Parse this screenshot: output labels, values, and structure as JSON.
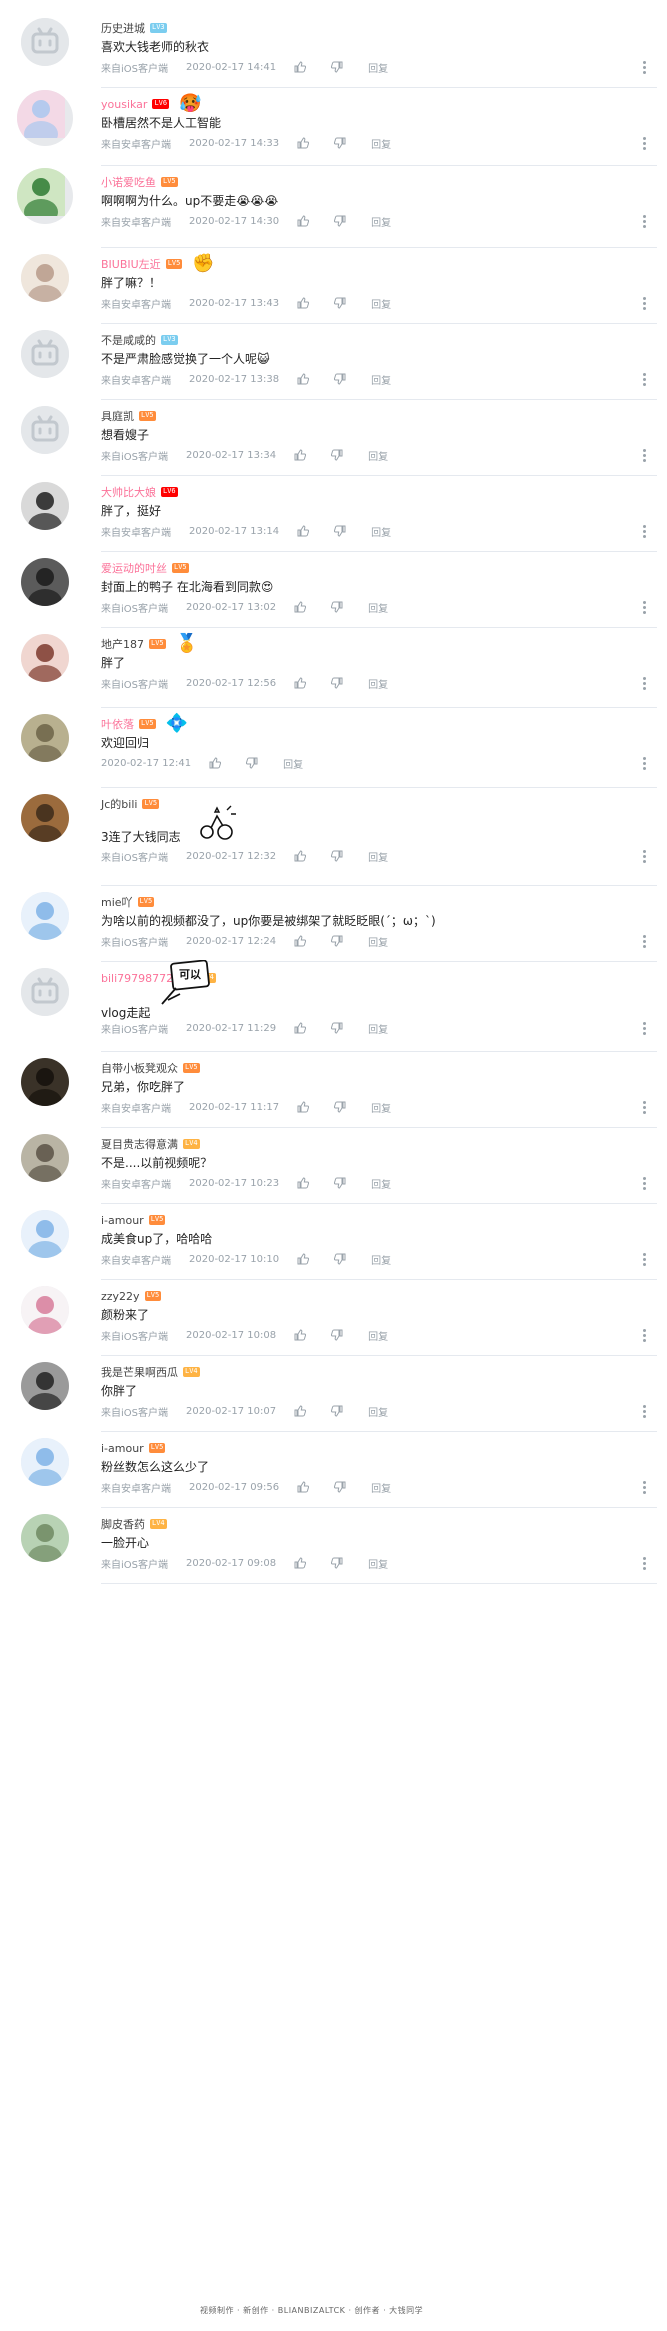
{
  "ui": {
    "reply_label": "回复",
    "colors": {
      "vip_name": "#fb7299",
      "meta": "#99a2aa",
      "separator": "#e5e9ef"
    }
  },
  "comments": [
    {
      "name": "历史进城",
      "vip": false,
      "level": "LV3",
      "text": "喜欢大钱老师的秋衣",
      "source": "来自iOS客户端",
      "time": "2020-02-17 14:41",
      "avatar": "default-tv-avatar",
      "pendant": ""
    },
    {
      "name": "yousikar",
      "vip": true,
      "level": "LV6",
      "text": "卧槽居然不是人工智能",
      "source": "来自安卓客户端",
      "time": "2020-02-17 14:33",
      "avatar": "pendant-frame-avatar",
      "pendant": "🥵"
    },
    {
      "name": "小诺爱吃鱼",
      "vip": true,
      "level": "LV5",
      "text": "啊啊啊为什么。up不要走😭😭😭",
      "source": "来自安卓客户端",
      "time": "2020-02-17 14:30",
      "avatar": "snake-frame-avatar",
      "pendant": ""
    },
    {
      "name": "BIUBIU左近",
      "vip": true,
      "level": "LV5",
      "text": "胖了嘛？！",
      "source": "来自安卓客户端",
      "time": "2020-02-17 13:43",
      "avatar": "anime-avatar",
      "pendant": "✊"
    },
    {
      "name": "不是咸咸的",
      "vip": false,
      "level": "LV3",
      "text": "不是严肃脸感觉换了一个人呢😺",
      "source": "来自安卓客户端",
      "time": "2020-02-17 13:38",
      "avatar": "default-tv-avatar",
      "pendant": ""
    },
    {
      "name": "具庭凯",
      "vip": false,
      "level": "LV5",
      "text": "想看嫂子",
      "source": "来自iOS客户端",
      "time": "2020-02-17 13:34",
      "avatar": "default-tv-avatar",
      "pendant": ""
    },
    {
      "name": "大帅比大娘",
      "vip": true,
      "level": "LV6",
      "text": "胖了，挺好",
      "source": "来自安卓客户端",
      "time": "2020-02-17 13:14",
      "avatar": "man-glasses-avatar",
      "pendant": ""
    },
    {
      "name": "爱运动的吋丝",
      "vip": true,
      "level": "LV5",
      "text": "封面上的鸭子 在北海看到同款😍",
      "source": "来自iOS客户端",
      "time": "2020-02-17 13:02",
      "avatar": "dark-photo-avatar",
      "pendant": ""
    },
    {
      "name": "地产187",
      "vip": false,
      "level": "LV5",
      "text": "胖了",
      "source": "来自iOS客户端",
      "time": "2020-02-17 12:56",
      "avatar": "girl-photo-avatar",
      "pendant": "🏅"
    },
    {
      "name": "叶依落",
      "vip": true,
      "level": "LV5",
      "text": "欢迎回归",
      "source": "",
      "time": "2020-02-17 12:41",
      "avatar": "cat-photo-avatar",
      "pendant": "💠"
    },
    {
      "name": "Jc的bili",
      "vip": false,
      "level": "LV5",
      "text": "3连了大钱同志",
      "source": "来自iOS客户端",
      "time": "2020-02-17 12:32",
      "avatar": "brown-photo-avatar",
      "pendant": ""
    },
    {
      "name": "mie吖",
      "vip": false,
      "level": "LV5",
      "text": "为啥以前的视频都没了，up你要是被绑架了就眨眨眼(´；ω；`)",
      "source": "来自iOS客户端",
      "time": "2020-02-17 12:24",
      "avatar": "anime-blue-avatar",
      "pendant": ""
    },
    {
      "name": "bili79798772287",
      "vip": true,
      "level": "LV4",
      "text": "vlog走起",
      "source": "来自iOS客户端",
      "time": "2020-02-17 11:29",
      "avatar": "default-tv-avatar",
      "pendant": "",
      "sticker_text": "可以"
    },
    {
      "name": "自带小板凳观众",
      "vip": false,
      "level": "LV5",
      "text": "兄弟，你吃胖了",
      "source": "来自安卓客户端",
      "time": "2020-02-17 11:17",
      "avatar": "dark-game-avatar",
      "pendant": ""
    },
    {
      "name": "夏目贵志得意满",
      "vip": false,
      "level": "LV4",
      "text": "不是....以前视频呢？",
      "source": "来自安卓客户端",
      "time": "2020-02-17 10:23",
      "avatar": "street-photo-avatar",
      "pendant": ""
    },
    {
      "name": "i-amour",
      "vip": false,
      "level": "LV5",
      "text": "成美食up了，哈哈哈",
      "source": "来自安卓客户端",
      "time": "2020-02-17 10:10",
      "avatar": "anime-blue-avatar",
      "pendant": ""
    },
    {
      "name": "zzy22y",
      "vip": false,
      "level": "LV5",
      "text": "颜粉来了",
      "source": "来自iOS客户端",
      "time": "2020-02-17 10:08",
      "avatar": "anime-white-avatar",
      "pendant": ""
    },
    {
      "name": "我是芒果啊西瓜",
      "vip": false,
      "level": "LV4",
      "text": "你胖了",
      "source": "来自iOS客户端",
      "time": "2020-02-17 10:07",
      "avatar": "bw-photo-avatar",
      "pendant": ""
    },
    {
      "name": "i-amour",
      "vip": false,
      "level": "LV5",
      "text": "粉丝数怎么这么少了",
      "source": "来自安卓客户端",
      "time": "2020-02-17 09:56",
      "avatar": "anime-blue-avatar",
      "pendant": ""
    },
    {
      "name": "脚皮香药",
      "vip": false,
      "level": "LV4",
      "text": "一脸开心",
      "source": "来自iOS客户端",
      "time": "2020-02-17 09:08",
      "avatar": "field-photo-avatar",
      "pendant": ""
    }
  ],
  "footer": {
    "text": "视频制作 · 新创作 · BLIANBIZALTCK · 创作者 · 大钱同学"
  }
}
